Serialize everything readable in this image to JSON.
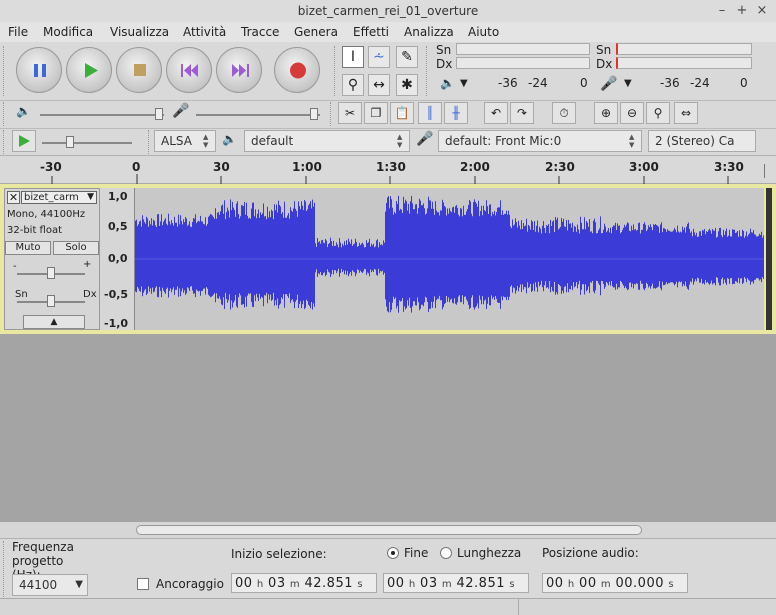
{
  "window": {
    "title": "bizet_carmen_rei_01_overture",
    "minimize": "–",
    "maximize": "+",
    "close": "×"
  },
  "menu": [
    "File",
    "Modifica",
    "Visualizza",
    "Attività",
    "Tracce",
    "Genera",
    "Effetti",
    "Analizza",
    "Aiuto"
  ],
  "meters": {
    "playback": {
      "left_label": "Sn",
      "right_label": "Dx",
      "scale": [
        "-36",
        "-24",
        "0"
      ]
    },
    "record": {
      "left_label": "Sn",
      "right_label": "Dx",
      "scale": [
        "-36",
        "-24",
        "0"
      ]
    }
  },
  "device": {
    "host": "ALSA",
    "output": "default",
    "input": "default: Front Mic:0",
    "channels": "2 (Stereo) Ca"
  },
  "ruler": [
    "-30",
    "0",
    "30",
    "1:00",
    "1:30",
    "2:00",
    "2:30",
    "3:00",
    "3:30"
  ],
  "track": {
    "name": "bizet_carm",
    "info1": "Mono, 44100Hz",
    "info2": "32-bit float",
    "mute": "Muto",
    "solo": "Solo",
    "pan_left": "Sn",
    "pan_right": "Dx",
    "gain_minus": "-",
    "gain_plus": "+",
    "scale": [
      "1,0",
      "0,5",
      "0,0",
      "-0,5",
      "-1,0"
    ],
    "waveform_color": "#3b3bd8"
  },
  "selection": {
    "rate_label": "Frequenza progetto (Hz):",
    "rate_value": "44100",
    "snap_label": "Ancoraggio",
    "start_label": "Inizio selezione:",
    "end_option": "Fine",
    "length_option": "Lunghezza",
    "audio_pos_label": "Posizione audio:",
    "start": {
      "h": "00",
      "m": "03",
      "s": "42.851"
    },
    "end": {
      "h": "00",
      "m": "03",
      "s": "42.851"
    },
    "audio_pos": {
      "h": "00",
      "m": "00",
      "s": "00.000"
    },
    "unit_h": "h",
    "unit_m": "m",
    "unit_s": "s"
  }
}
